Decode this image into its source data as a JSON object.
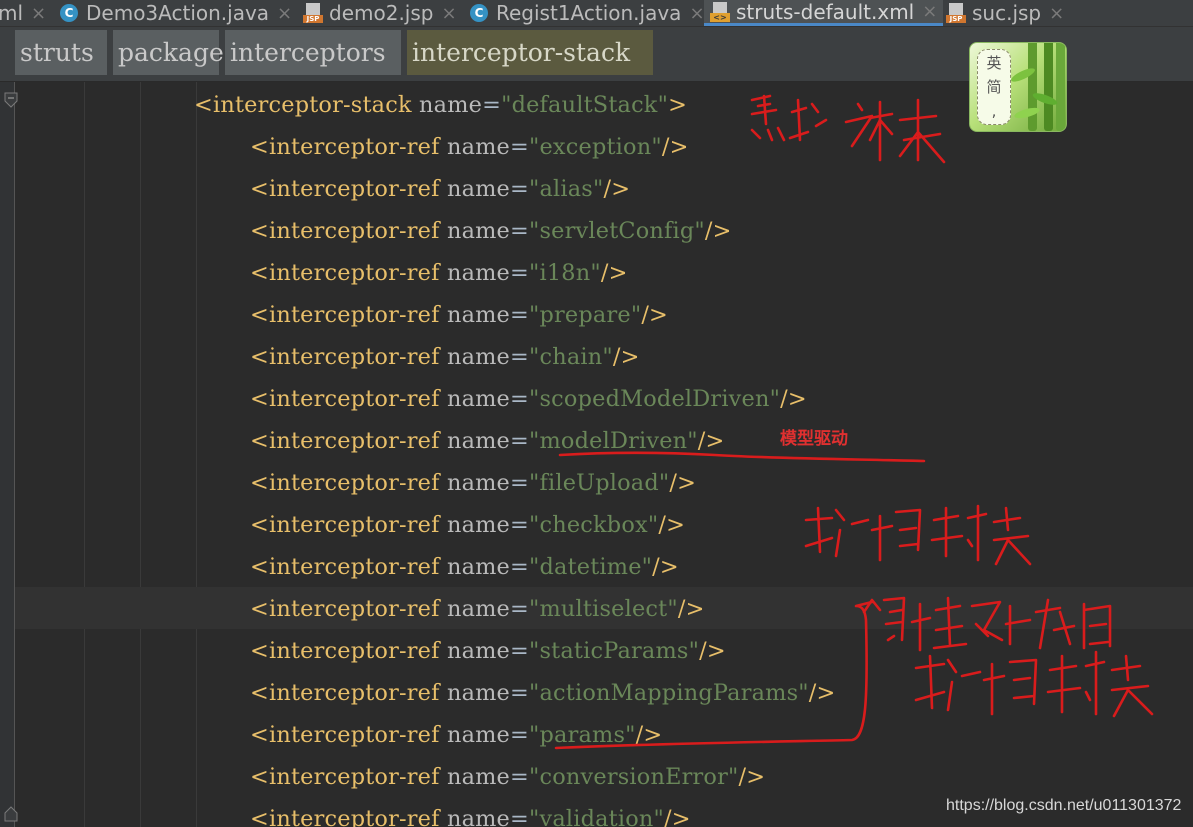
{
  "tabs": [
    {
      "name": "ml",
      "icon": "none",
      "active": false
    },
    {
      "name": "Demo3Action.java",
      "icon": "class-icon",
      "active": false
    },
    {
      "name": "demo2.jsp",
      "icon": "jsp-file-icon",
      "active": false
    },
    {
      "name": "Regist1Action.java",
      "icon": "class-icon",
      "active": false
    },
    {
      "name": "struts-default.xml",
      "icon": "xml-file-icon",
      "active": true
    },
    {
      "name": "suc.jsp",
      "icon": "jsp-file-icon",
      "active": false
    }
  ],
  "tab_close_glyph": "×",
  "icon_labels": {
    "class": "C",
    "jsp": "JSP",
    "xml": "<>"
  },
  "breadcrumbs": [
    "struts",
    "package",
    "interceptors",
    "interceptor-stack"
  ],
  "ime": {
    "line1": "英",
    "line2": "简",
    "line3": ","
  },
  "code": {
    "stack_open": {
      "tag": "interceptor-stack",
      "attr": "name",
      "value": "defaultStack"
    },
    "ref_tag": "interceptor-ref",
    "ref_attr": "name",
    "refs": [
      "exception",
      "alias",
      "servletConfig",
      "i18n",
      "prepare",
      "chain",
      "scopedModelDriven",
      "modelDriven",
      "fileUpload",
      "checkbox",
      "datetime",
      "multiselect",
      "staticParams",
      "actionMappingParams",
      "params",
      "conversionError",
      "validation"
    ],
    "current_line_value": "multiselect"
  },
  "annotations": {
    "model_driven": "模型驱动"
  },
  "watermark": "https://blog.csdn.net/u011301372",
  "colors": {
    "background": "#2b2b2b",
    "tag": "#e8bf6a",
    "attribute": "#bababa",
    "value": "#6a8759",
    "annotation": "#e03030",
    "active_tab_underline": "#4a88c7"
  }
}
